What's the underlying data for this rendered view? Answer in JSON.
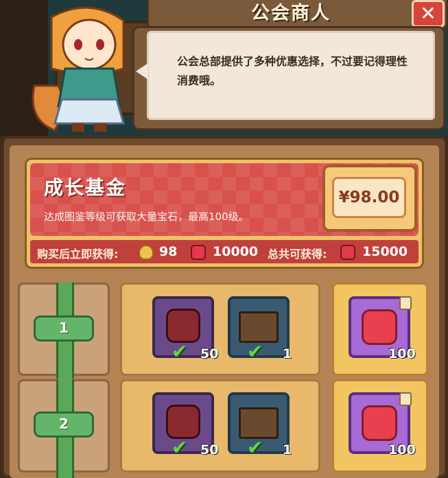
{
  "header": {
    "title": "公会商人",
    "close_icon": "close-icon",
    "dialog_text": "公会总部提供了多种优惠选择，不过要记得理性消费哦。"
  },
  "promo": {
    "title": "成长基金",
    "description": "达成图鉴等级可获取大量宝石，最高100级。",
    "price": "¥98.00",
    "immediate_label": "购买后立即获得:",
    "immediate_gold": "98",
    "immediate_gems": "10000",
    "total_label": "总共可获得:",
    "total_gems": "15000"
  },
  "rows": [
    {
      "level": "1",
      "free_gem_qty": "50",
      "free_book_qty": "1",
      "paid_gem_qty": "100"
    },
    {
      "level": "2",
      "free_gem_qty": "50",
      "free_book_qty": "1",
      "paid_gem_qty": "100"
    }
  ],
  "colors": {
    "accent_red": "#d8514c",
    "gold": "#f0c267",
    "green": "#64b56a",
    "gem": "#e84050"
  }
}
